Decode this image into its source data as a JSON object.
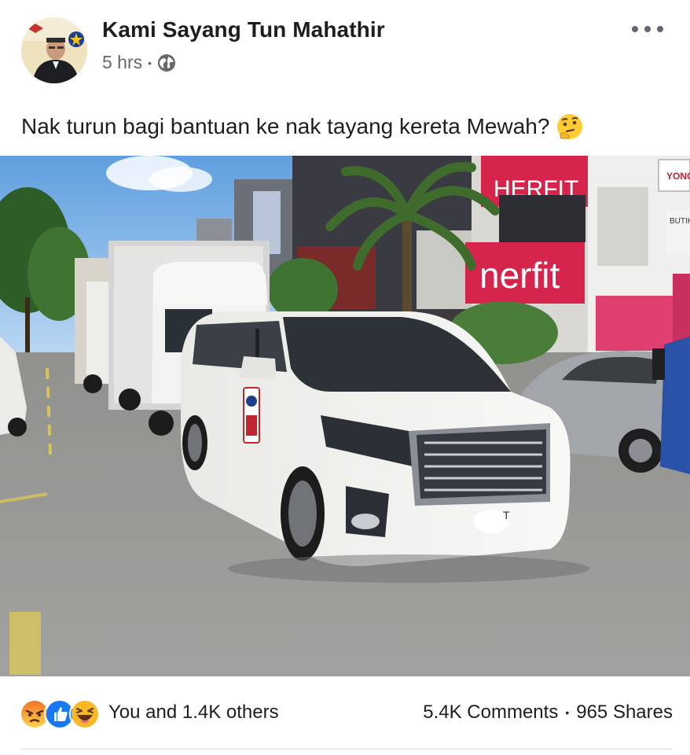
{
  "post": {
    "page_name": "Kami Sayang Tun Mahathir",
    "time": "5 hrs",
    "meta_separator": "•",
    "privacy_icon": "globe-icon",
    "text": "Nak turun bagi bantuan ke nak tayang kereta Mewah?",
    "text_emoji": "thinking-face-emoji"
  },
  "photo": {
    "signs": {
      "top_right": "HERFIT",
      "middle_right": "nerfit",
      "corner": "YONG",
      "corner2": "BUTIK"
    },
    "plate_text": "T"
  },
  "footer": {
    "reactions": [
      "angry-emoji",
      "like-emoji",
      "haha-emoji"
    ],
    "reaction_text": "You and 1.4K others",
    "comments": "5.4K Comments",
    "stats_separator": "•",
    "shares": "965 Shares"
  },
  "colors": {
    "like_blue": "#1877f2",
    "angry_orange": "#f0742a",
    "haha_yellow": "#f7b928",
    "sign_pink": "#d6254d"
  }
}
